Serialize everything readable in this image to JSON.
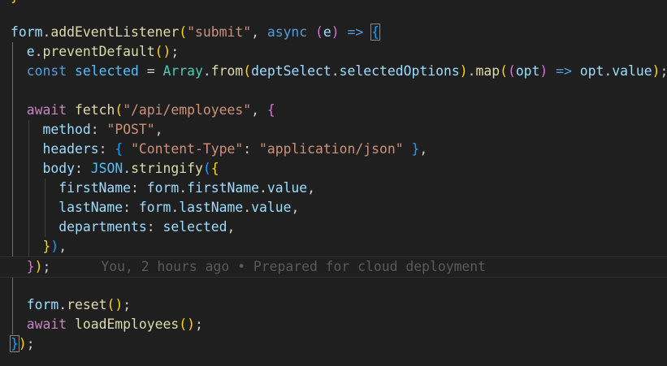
{
  "editor": {
    "language": "javascript",
    "theme_background": "#1f1f1f",
    "lines": [
      {
        "segs": [
          [
            "tok-var",
            "form"
          ],
          [
            "tok-punc",
            "."
          ],
          [
            "tok-fn",
            "addEventListener"
          ],
          [
            "b1",
            "("
          ],
          [
            "tok-str",
            "\"submit\""
          ],
          [
            "tok-punc",
            ", "
          ],
          [
            "tok-kw",
            "async"
          ],
          [
            "tok-punc",
            " "
          ],
          [
            "b2",
            "("
          ],
          [
            "tok-var",
            "e"
          ],
          [
            "b2",
            ")"
          ],
          [
            "tok-punc",
            " "
          ],
          [
            "tok-kw",
            "=>"
          ],
          [
            "tok-punc",
            " "
          ],
          [
            "b3 bm",
            "{"
          ]
        ]
      },
      {
        "segs": [
          [
            "tok-punc",
            "  "
          ],
          [
            "tok-var",
            "e"
          ],
          [
            "tok-punc",
            "."
          ],
          [
            "tok-fn",
            "preventDefault"
          ],
          [
            "b1",
            "()"
          ],
          [
            "tok-punc",
            ";"
          ]
        ]
      },
      {
        "segs": [
          [
            "tok-punc",
            "  "
          ],
          [
            "tok-kw",
            "const"
          ],
          [
            "tok-punc",
            " "
          ],
          [
            "tok-const",
            "selected"
          ],
          [
            "tok-punc",
            " = "
          ],
          [
            "tok-class",
            "Array"
          ],
          [
            "tok-punc",
            "."
          ],
          [
            "tok-fn",
            "from"
          ],
          [
            "b1",
            "("
          ],
          [
            "tok-var",
            "deptSelect"
          ],
          [
            "tok-punc",
            "."
          ],
          [
            "tok-var",
            "selectedOptions"
          ],
          [
            "b1",
            ")"
          ],
          [
            "tok-punc",
            "."
          ],
          [
            "tok-fn",
            "map"
          ],
          [
            "b1",
            "("
          ],
          [
            "b2",
            "("
          ],
          [
            "tok-var",
            "opt"
          ],
          [
            "b2",
            ")"
          ],
          [
            "tok-punc",
            " "
          ],
          [
            "tok-kw",
            "=>"
          ],
          [
            "tok-punc",
            " "
          ],
          [
            "tok-var",
            "opt"
          ],
          [
            "tok-punc",
            "."
          ],
          [
            "tok-var",
            "value"
          ],
          [
            "b1",
            ")"
          ],
          [
            "tok-punc",
            ";"
          ]
        ]
      },
      {
        "segs": []
      },
      {
        "segs": [
          [
            "tok-punc",
            "  "
          ],
          [
            "tok-kwc",
            "await"
          ],
          [
            "tok-punc",
            " "
          ],
          [
            "tok-fn",
            "fetch"
          ],
          [
            "b1",
            "("
          ],
          [
            "tok-str",
            "\"/api/employees\""
          ],
          [
            "tok-punc",
            ", "
          ],
          [
            "b2",
            "{"
          ]
        ]
      },
      {
        "segs": [
          [
            "tok-punc",
            "    "
          ],
          [
            "tok-var",
            "method"
          ],
          [
            "tok-punc",
            ": "
          ],
          [
            "tok-str",
            "\"POST\""
          ],
          [
            "tok-punc",
            ","
          ]
        ]
      },
      {
        "segs": [
          [
            "tok-punc",
            "    "
          ],
          [
            "tok-var",
            "headers"
          ],
          [
            "tok-punc",
            ": "
          ],
          [
            "b3",
            "{"
          ],
          [
            "tok-punc",
            " "
          ],
          [
            "tok-str",
            "\"Content-Type\""
          ],
          [
            "tok-punc",
            ": "
          ],
          [
            "tok-str",
            "\"application/json\""
          ],
          [
            "tok-punc",
            " "
          ],
          [
            "b3",
            "}"
          ],
          [
            "tok-punc",
            ","
          ]
        ]
      },
      {
        "segs": [
          [
            "tok-punc",
            "    "
          ],
          [
            "tok-var",
            "body"
          ],
          [
            "tok-punc",
            ": "
          ],
          [
            "tok-const",
            "JSON"
          ],
          [
            "tok-punc",
            "."
          ],
          [
            "tok-fn",
            "stringify"
          ],
          [
            "b3",
            "("
          ],
          [
            "b1",
            "{"
          ]
        ]
      },
      {
        "segs": [
          [
            "tok-punc",
            "      "
          ],
          [
            "tok-var",
            "firstName"
          ],
          [
            "tok-punc",
            ": "
          ],
          [
            "tok-var",
            "form"
          ],
          [
            "tok-punc",
            "."
          ],
          [
            "tok-var",
            "firstName"
          ],
          [
            "tok-punc",
            "."
          ],
          [
            "tok-var",
            "value"
          ],
          [
            "tok-punc",
            ","
          ]
        ]
      },
      {
        "segs": [
          [
            "tok-punc",
            "      "
          ],
          [
            "tok-var",
            "lastName"
          ],
          [
            "tok-punc",
            ": "
          ],
          [
            "tok-var",
            "form"
          ],
          [
            "tok-punc",
            "."
          ],
          [
            "tok-var",
            "lastName"
          ],
          [
            "tok-punc",
            "."
          ],
          [
            "tok-var",
            "value"
          ],
          [
            "tok-punc",
            ","
          ]
        ]
      },
      {
        "segs": [
          [
            "tok-punc",
            "      "
          ],
          [
            "tok-var",
            "departments"
          ],
          [
            "tok-punc",
            ": "
          ],
          [
            "tok-var",
            "selected"
          ],
          [
            "tok-punc",
            ","
          ]
        ]
      },
      {
        "segs": [
          [
            "tok-punc",
            "    "
          ],
          [
            "b1",
            "}"
          ],
          [
            "b3",
            ")"
          ],
          [
            "tok-punc",
            ","
          ]
        ]
      },
      {
        "segs": [
          [
            "tok-punc",
            "  "
          ],
          [
            "b2",
            "}"
          ],
          [
            "b1",
            ")"
          ],
          [
            "tok-punc",
            ";"
          ]
        ],
        "current": true,
        "blame": "You, 2 hours ago • Prepared for cloud deployment"
      },
      {
        "segs": []
      },
      {
        "segs": [
          [
            "tok-punc",
            "  "
          ],
          [
            "tok-var",
            "form"
          ],
          [
            "tok-punc",
            "."
          ],
          [
            "tok-fn",
            "reset"
          ],
          [
            "b1",
            "()"
          ],
          [
            "tok-punc",
            ";"
          ]
        ]
      },
      {
        "segs": [
          [
            "tok-punc",
            "  "
          ],
          [
            "tok-kwc",
            "await"
          ],
          [
            "tok-punc",
            " "
          ],
          [
            "tok-fn",
            "loadEmployees"
          ],
          [
            "b1",
            "()"
          ],
          [
            "tok-punc",
            ";"
          ]
        ]
      },
      {
        "segs": [
          [
            "b3 bm",
            "}"
          ],
          [
            "b1",
            ")"
          ],
          [
            "tok-punc",
            ";"
          ]
        ]
      }
    ],
    "top_fragment": "}"
  }
}
